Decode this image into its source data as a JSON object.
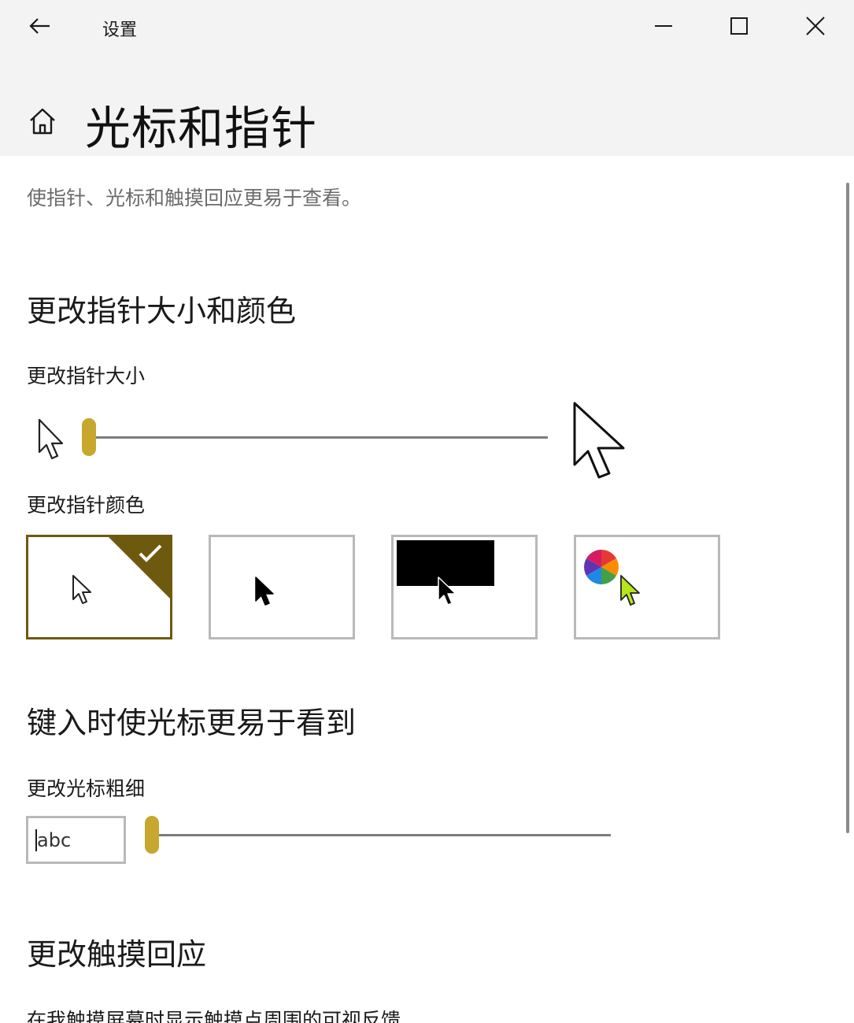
{
  "window": {
    "title": "设置",
    "back_icon": "arrow-left-icon",
    "minimize_icon": "minimize-icon",
    "maximize_icon": "maximize-icon",
    "close_icon": "close-icon"
  },
  "header": {
    "home_icon": "home-icon",
    "title": "光标和指针"
  },
  "intro": "使指针、光标和触摸回应更易于查看。",
  "pointer_section": {
    "title": "更改指针大小和颜色",
    "size_label": "更改指针大小",
    "size_slider_value": 0,
    "color_label": "更改指针颜色",
    "color_options": [
      {
        "name": "white-pointer",
        "selected": true
      },
      {
        "name": "black-pointer",
        "selected": false
      },
      {
        "name": "inverted-pointer",
        "selected": false
      },
      {
        "name": "custom-pointer",
        "selected": false
      }
    ],
    "accent_color": "#6e5a0e",
    "slider_color": "#c8a72e",
    "custom_pointer_color": "#b5e61d"
  },
  "cursor_section": {
    "title": "键入时使光标更易于看到",
    "thickness_label": "更改光标粗细",
    "preview_text": "abc",
    "thickness_slider_value": 0
  },
  "touch_section": {
    "title": "更改触摸回应",
    "feedback_label": "在我触摸屏幕时显示触摸点周围的可视反馈"
  }
}
